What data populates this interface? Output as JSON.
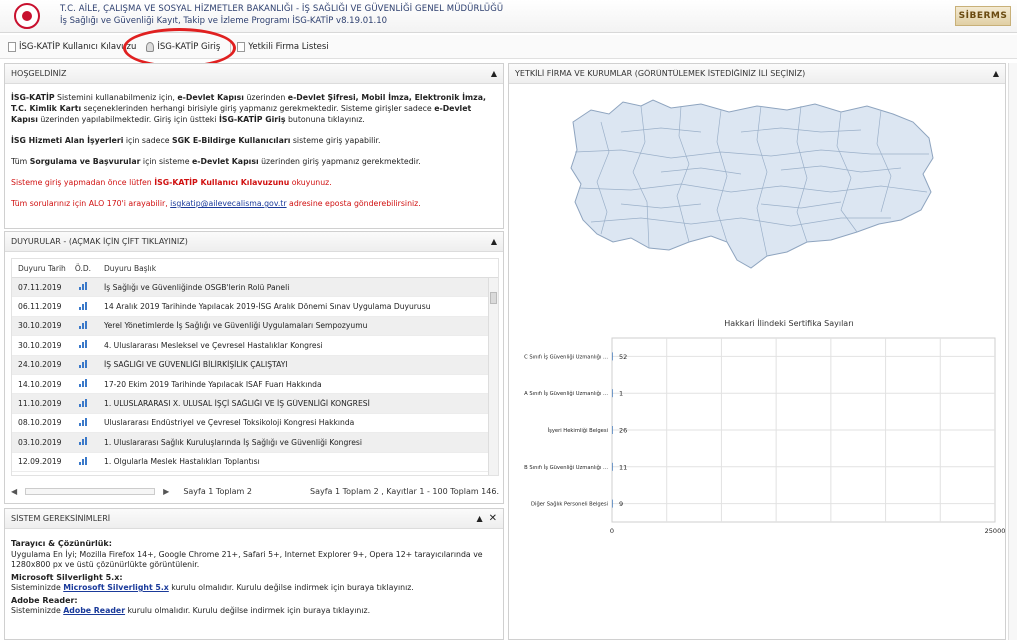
{
  "header": {
    "ministry": "T.C. AİLE, ÇALIŞMA VE SOSYAL HİZMETLER BAKANLIĞI - İŞ SAĞLIĞI VE GÜVENLİĞİ GENEL MÜDÜRLÜĞÜ",
    "program": "İş Sağlığı ve Güvenliği Kayıt, Takip ve İzleme Programı İSG-KATİP v8.19.01.10",
    "brand": "SİBERMS"
  },
  "toolbar": {
    "guide_label": "İSG-KATİP Kullanıcı Kılavuzu",
    "login_label": "İSG-KATİP Giriş",
    "firms_label": "Yetkili Firma Listesi"
  },
  "welcome": {
    "title": "HOŞGELDİNİZ",
    "p1_a": "İSG-KATİP",
    "p1_b": " Sistemini kullanabilmeniz için, ",
    "p1_c": "e-Devlet Kapısı",
    "p1_d": " üzerinden ",
    "p1_e": "e-Devlet Şifresi, Mobil İmza, Elektronik İmza, T.C. Kimlik Kartı",
    "p1_f": " seçeneklerinden herhangi birisiyle giriş yapmanız gerekmektedir. Sisteme girişler sadece ",
    "p1_g": "e-Devlet Kapısı",
    "p1_h": " üzerinden yapılabilmektedir. Giriş için üstteki ",
    "p1_i": "İSG-KATİP Giriş",
    "p1_j": " butonuna tıklayınız.",
    "p2_a": "İSG Hizmeti Alan İşyerleri",
    "p2_b": " için sadece ",
    "p2_c": "SGK E-Bildirge Kullanıcıları",
    "p2_d": " sisteme giriş yapabilir.",
    "p3_a": "Tüm ",
    "p3_b": "Sorgulama ve Başvurular",
    "p3_c": " için sisteme ",
    "p3_d": "e-Devlet Kapısı",
    "p3_e": " üzerinden giriş yapmanız gerekmektedir.",
    "p4_a": "Sisteme giriş yapmadan önce lütfen ",
    "p4_b": "İSG-KATİP Kullanıcı Kılavuzunu",
    "p4_c": " okuyunuz.",
    "p5_a": "Tüm sorularınız için ALO 170'i arayabilir, ",
    "p5_link": "isgkatip@ailevecalisma.gov.tr",
    "p5_b": " adresine eposta gönderebilirsiniz."
  },
  "announcements": {
    "title": "DUYURULAR - (AÇMAK İÇİN ÇİFT TIKLAYINIZ)",
    "columns": [
      "Duyuru Tarih",
      "Ö.D.",
      "Duyuru Başlık"
    ],
    "rows": [
      {
        "date": "07.11.2019",
        "title": "İş Sağlığı ve Güvenliğinde OSGB'lerin Rolü Paneli"
      },
      {
        "date": "06.11.2019",
        "title": "14 Aralık 2019 Tarihinde Yapılacak 2019-İSG Aralık Dönemi Sınav Uygulama Duyurusu"
      },
      {
        "date": "30.10.2019",
        "title": "Yerel Yönetimlerde İş Sağlığı ve Güvenliği Uygulamaları Sempozyumu"
      },
      {
        "date": "30.10.2019",
        "title": "4. Uluslararası Mesleksel ve Çevresel Hastalıklar Kongresi"
      },
      {
        "date": "24.10.2019",
        "title": "İŞ SAĞLIĞI VE GÜVENLİĞİ BİLİRKİŞİLİK ÇALIŞTAYI"
      },
      {
        "date": "14.10.2019",
        "title": "17-20 Ekim 2019 Tarihinde Yapılacak ISAF Fuarı Hakkında"
      },
      {
        "date": "11.10.2019",
        "title": "1. ULUSLARARASI X. ULUSAL İŞÇİ SAĞLIĞI VE İŞ GÜVENLİĞİ KONGRESİ"
      },
      {
        "date": "08.10.2019",
        "title": "Uluslararası Endüstriyel ve Çevresel Toksikoloji Kongresi Hakkında"
      },
      {
        "date": "03.10.2019",
        "title": "1. Uluslararası Sağlık Kuruluşlarında İş Sağlığı ve Güvenliği Kongresi"
      },
      {
        "date": "12.09.2019",
        "title": "1. Olgularla Meslek Hastalıkları Toplantısı"
      }
    ],
    "pager_left": "Sayfa 1 Toplam 2",
    "pager_right": "Sayfa 1 Toplam 2 , Kayıtlar 1 - 100 Toplam 146."
  },
  "sysreq": {
    "title": "SİSTEM GEREKSİNİMLERİ",
    "browser_h": "Tarayıcı & Çözünürlük:",
    "browser_t": "Uygulama En İyi; Mozilla Firefox 14+, Google Chrome 21+, Safari 5+, Internet Explorer 9+, Opera 12+ tarayıcılarında ve 1280x800 px ve üstü çözünürlükte görüntülenir.",
    "silverlight_h": "Microsoft Silverlight 5.x:",
    "silverlight_a": "Sisteminizde ",
    "silverlight_link": "Microsoft Silverlight 5.x",
    "silverlight_b": " kurulu olmalıdır. Kurulu değilse indirmek için buraya tıklayınız.",
    "reader_h": "Adobe Reader:",
    "reader_a": "Sisteminizde ",
    "reader_link": "Adobe Reader",
    "reader_b": " kurulu olmalıdır. Kurulu değilse indirmek için buraya tıklayınız."
  },
  "firms": {
    "title": "YETKİLİ FİRMA VE KURUMLAR (GÖRÜNTÜLEMEK İSTEDİĞİNİZ İLİ SEÇİNİZ)"
  },
  "chart_data": {
    "type": "bar",
    "title": "Hakkari İlindeki Sertifika Sayıları",
    "categories": [
      "C Sınıfı İş Güvenliği Uzmanlığı ...",
      "A Sınıfı İş Güvenliği Uzmanlığı ...",
      "İşyeri Hekimliği Belgesi",
      "B Sınıfı İş Güvenliği Uzmanlığı ...",
      "Diğer Sağlık Personeli Belgesi"
    ],
    "values": [
      52,
      1,
      26,
      11,
      9
    ],
    "xlim": [
      0,
      25000
    ],
    "xticks": [
      "0",
      "25000"
    ],
    "grid": true,
    "bar_color": "#4f81bd"
  }
}
